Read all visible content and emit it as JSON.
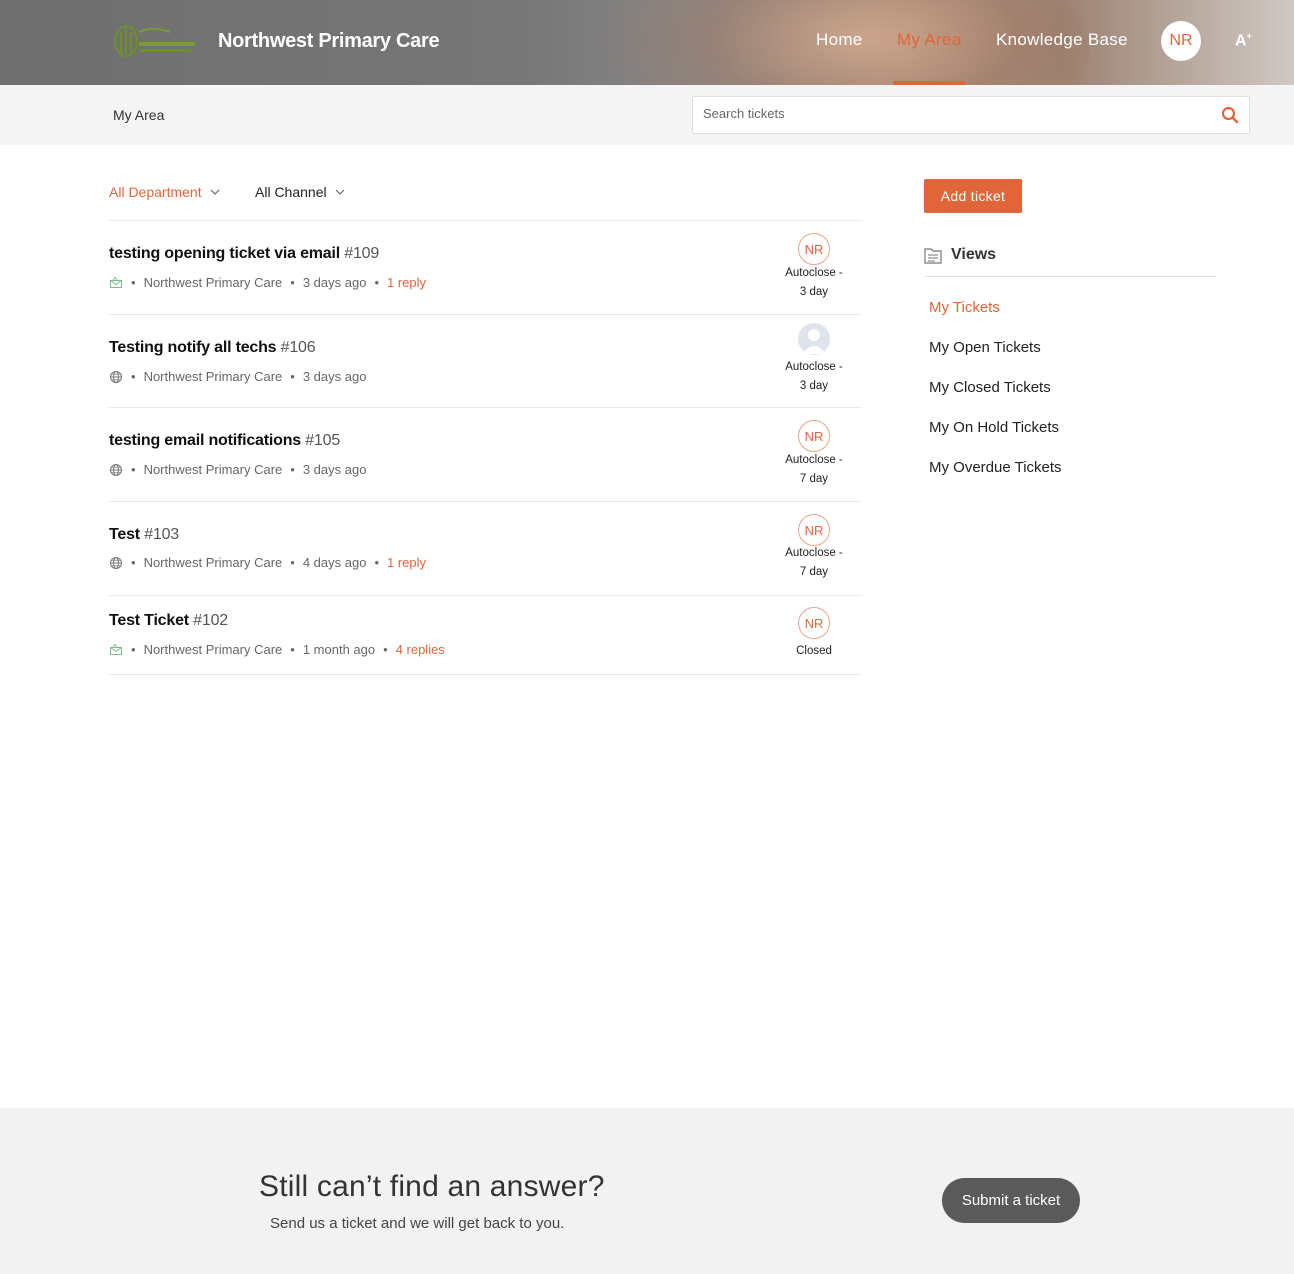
{
  "header": {
    "brand": "Northwest Primary Care",
    "nav": [
      {
        "label": "Home"
      },
      {
        "label": "My Area"
      },
      {
        "label": "Knowledge Base"
      }
    ],
    "avatar_initials": "NR",
    "accessibility_label": "A",
    "accent_color": "#e0663a"
  },
  "subheader": {
    "breadcrumb": "My Area",
    "search_placeholder": "Search tickets"
  },
  "filters": {
    "department": "All Department",
    "channel": "All Channel"
  },
  "tickets": [
    {
      "title": "testing opening ticket via email",
      "number": "#109",
      "channel_icon": "email-icon",
      "department": "Northwest Primary Care",
      "time": "3 days ago",
      "replies": "1 reply",
      "assignee": "NR",
      "status_line1": "Autoclose -",
      "status_line2": "3 day"
    },
    {
      "title": "Testing notify all techs",
      "number": "#106",
      "channel_icon": "web-icon",
      "department": "Northwest Primary Care",
      "time": "3 days ago",
      "replies": "",
      "assignee": "",
      "status_line1": "Autoclose -",
      "status_line2": "3 day"
    },
    {
      "title": "testing email notifications",
      "number": "#105",
      "channel_icon": "web-icon",
      "department": "Northwest Primary Care",
      "time": "3 days ago",
      "replies": "",
      "assignee": "NR",
      "status_line1": "Autoclose -",
      "status_line2": "7 day"
    },
    {
      "title": "Test",
      "number": "#103",
      "channel_icon": "web-icon",
      "department": "Northwest Primary Care",
      "time": "4 days ago",
      "replies": "1 reply",
      "assignee": "NR",
      "status_line1": "Autoclose -",
      "status_line2": "7 day"
    },
    {
      "title": "Test Ticket",
      "number": "#102",
      "channel_icon": "email-icon",
      "department": "Northwest Primary Care",
      "time": "1 month ago",
      "replies": "4 replies",
      "assignee": "NR",
      "status_line1": "Closed",
      "status_line2": ""
    }
  ],
  "sidebar": {
    "add_ticket": "Add ticket",
    "views_title": "Views",
    "views": [
      {
        "label": "My Tickets",
        "active": true
      },
      {
        "label": "My Open Tickets"
      },
      {
        "label": "My Closed Tickets"
      },
      {
        "label": "My On Hold Tickets"
      },
      {
        "label": "My Overdue Tickets"
      }
    ]
  },
  "footer": {
    "title": "Still can’t find an answer?",
    "subtitle": "Send us a ticket and we will get back to you.",
    "submit_label": "Submit a ticket"
  }
}
